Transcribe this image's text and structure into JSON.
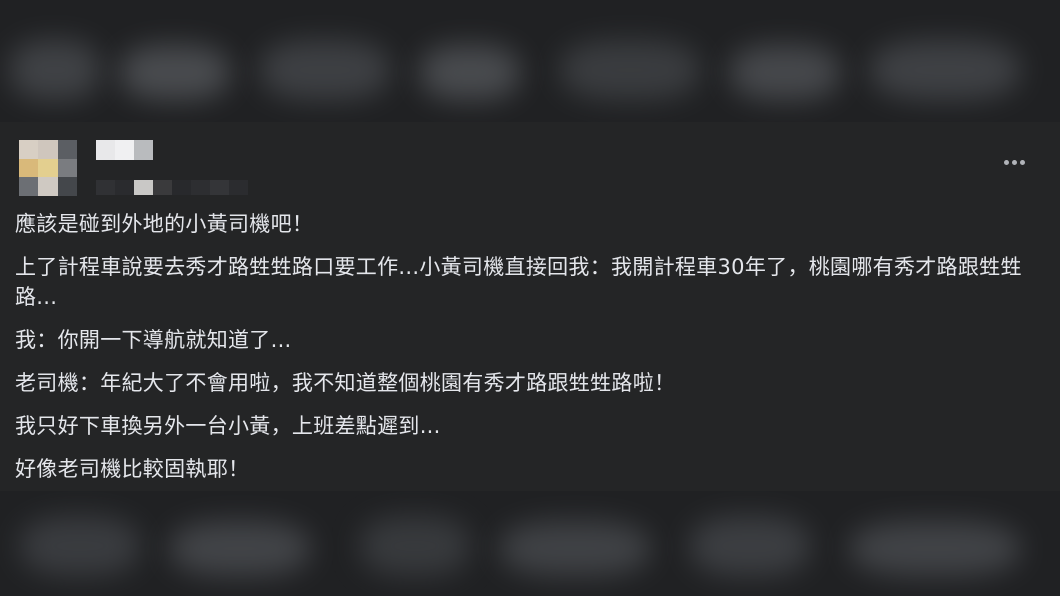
{
  "post": {
    "paragraphs": [
      "應該是碰到外地的小黃司機吧！",
      "上了計程車說要去秀才路甡甡路口要工作...小黃司機直接回我：我開計程車30年了，桃園哪有秀才路跟甡甡路...",
      "我：你開一下導航就知道了...",
      "老司機：年紀大了不會用啦，我不知道整個桃園有秀才路跟甡甡路啦！",
      "我只好下車換另外一台小黃，上班差點遲到...",
      "好像老司機比較固執耶！"
    ],
    "more_icon": "more-horizontal-icon",
    "colors": {
      "card_background": "#242526",
      "text": "#e4e6eb",
      "icon": "#b0b3b8"
    }
  }
}
